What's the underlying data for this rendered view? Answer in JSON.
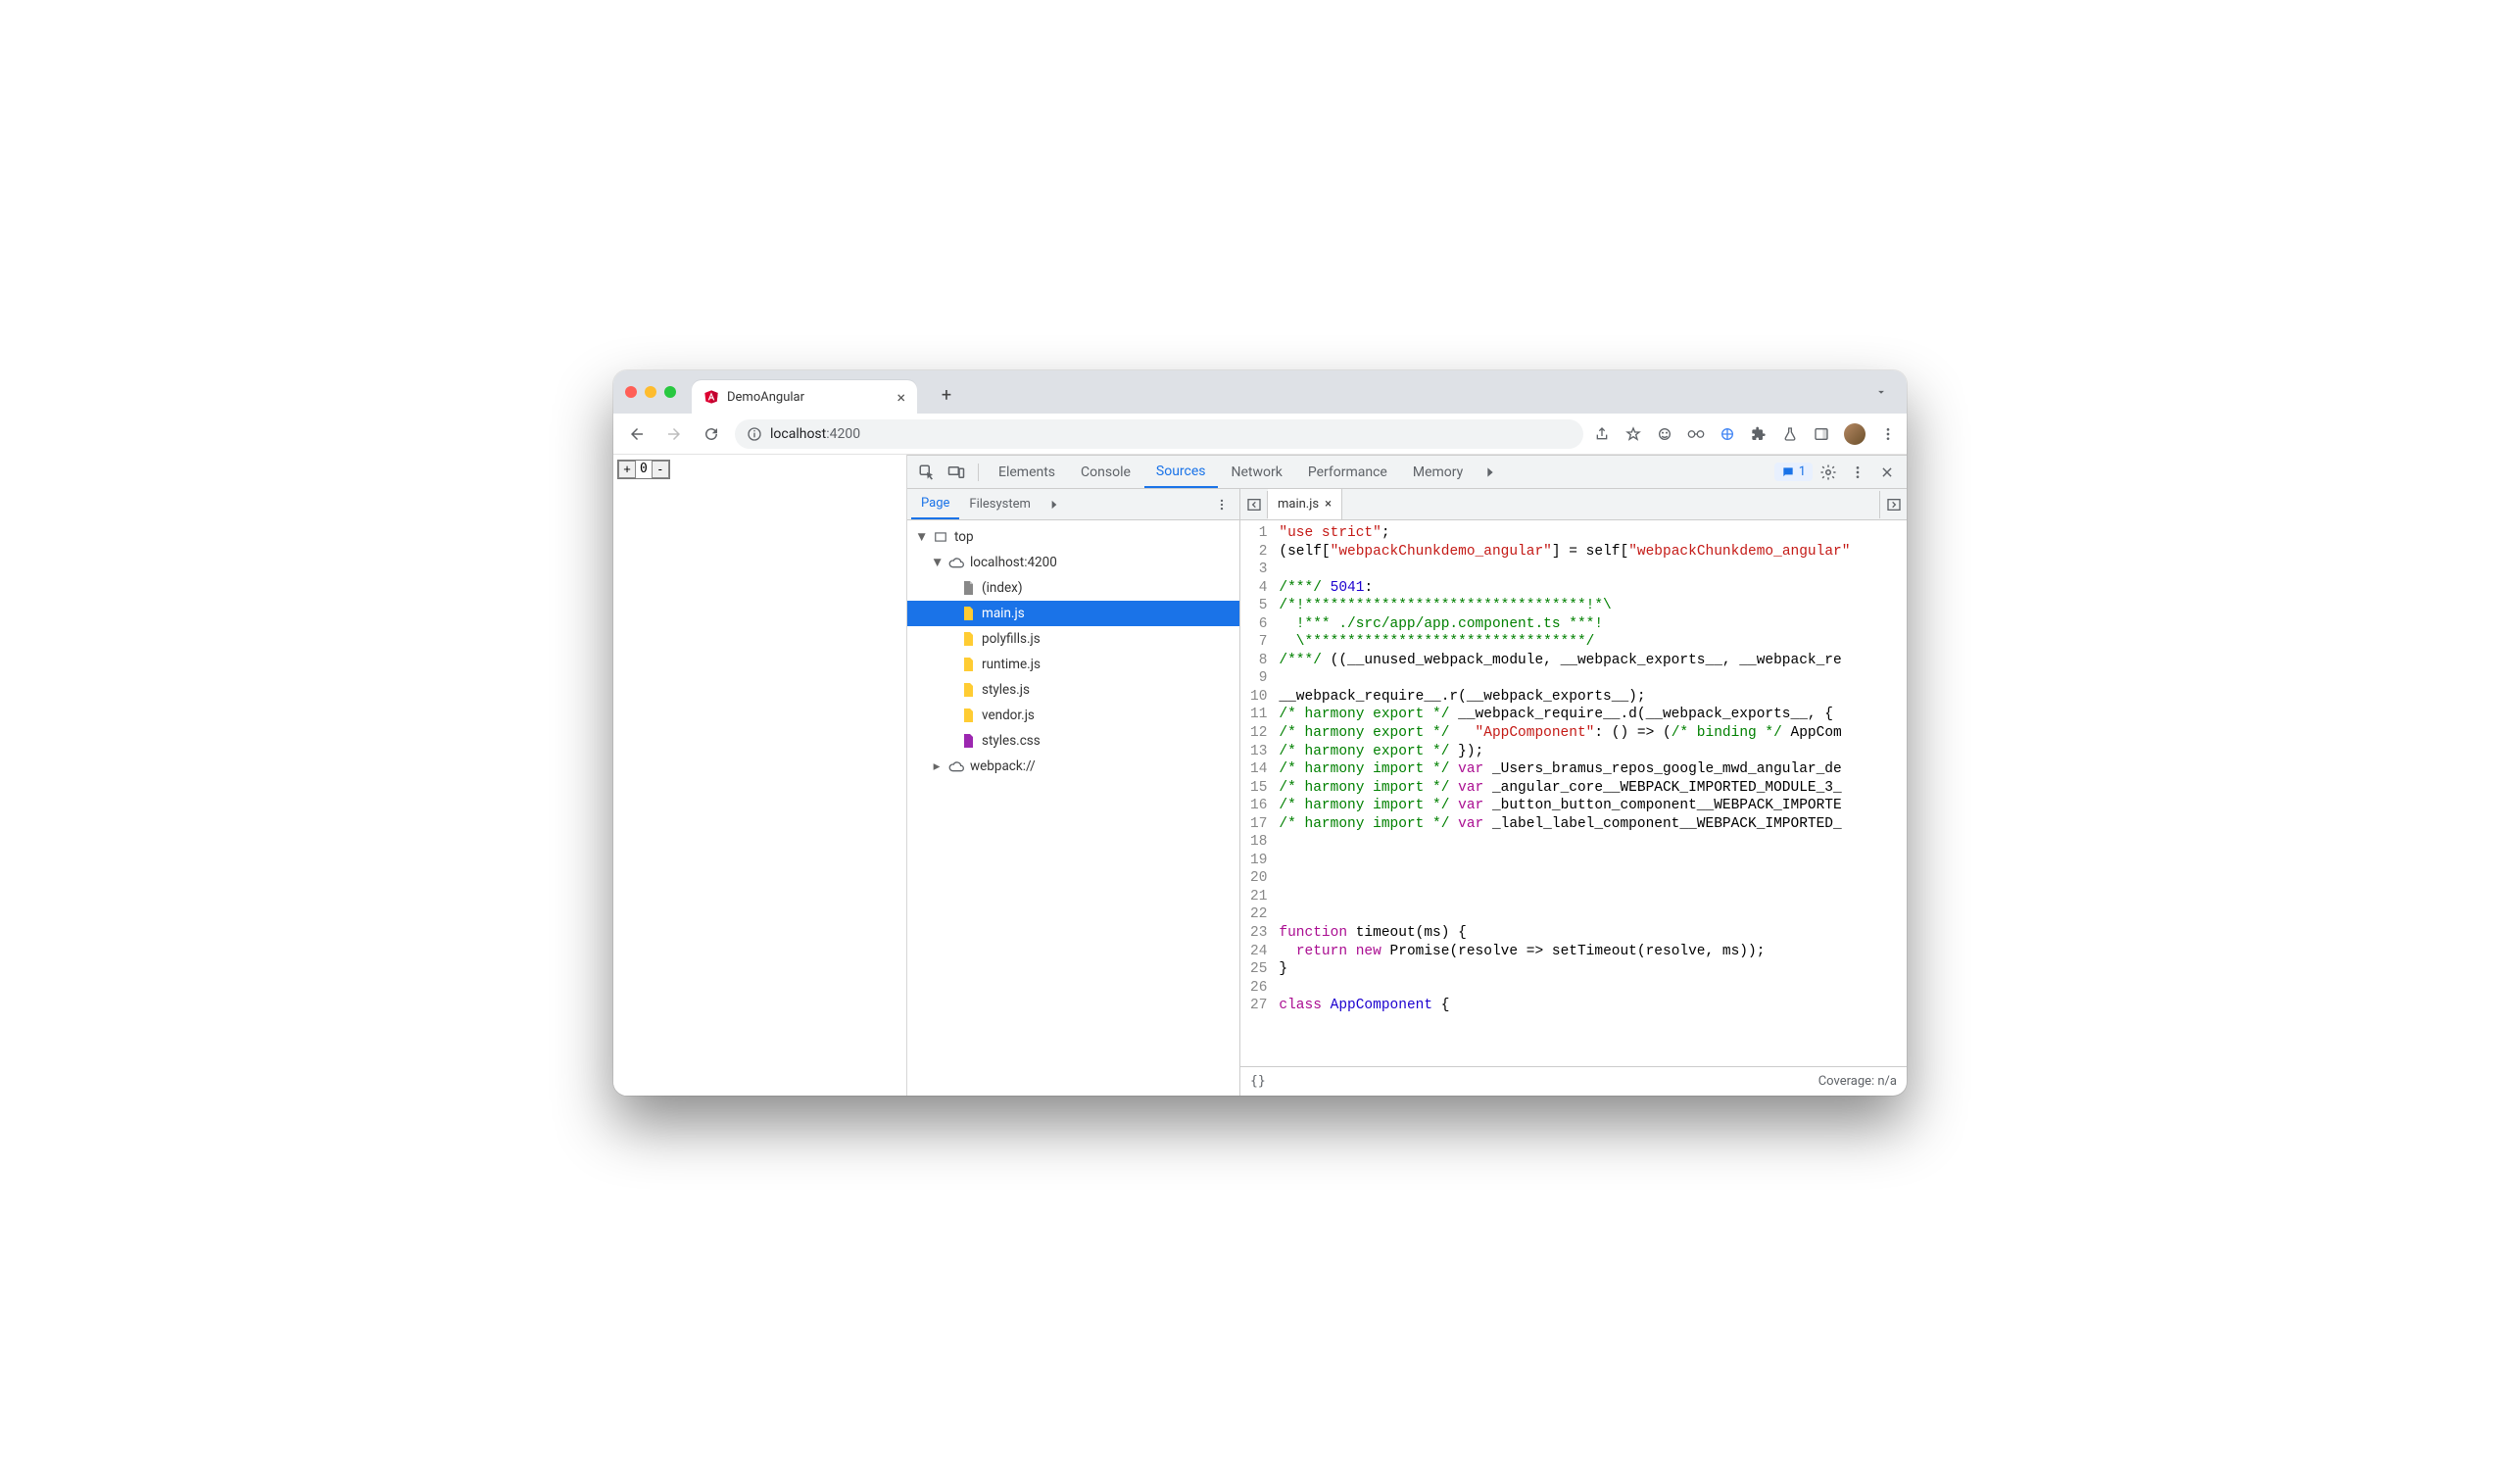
{
  "browser": {
    "tab_title": "DemoAngular",
    "url_display_prefix": "localhost",
    "url_display_suffix": ":4200"
  },
  "page": {
    "counter_value": "0"
  },
  "devtools": {
    "tabs": [
      "Elements",
      "Console",
      "Sources",
      "Network",
      "Performance",
      "Memory"
    ],
    "active_tab": "Sources",
    "issues_count": "1",
    "sources": {
      "left_tabs": [
        "Page",
        "Filesystem"
      ],
      "active_left_tab": "Page",
      "tree": {
        "top": "top",
        "origin": "localhost:4200",
        "files": [
          "(index)",
          "main.js",
          "polyfills.js",
          "runtime.js",
          "styles.js",
          "vendor.js",
          "styles.css"
        ],
        "selected": "main.js",
        "webpack": "webpack://"
      },
      "open_file": "main.js"
    },
    "status": {
      "coverage": "Coverage: n/a"
    },
    "code": {
      "lines": [
        [
          [
            "str",
            "\"use strict\""
          ],
          [
            "pln",
            ";"
          ]
        ],
        [
          [
            "pln",
            "(self["
          ],
          [
            "str",
            "\"webpackChunkdemo_angular\""
          ],
          [
            "pln",
            "] = self["
          ],
          [
            "str",
            "\"webpackChunkdemo_angular\""
          ]
        ],
        [
          [
            "pln",
            ""
          ]
        ],
        [
          [
            "com",
            "/***/ "
          ],
          [
            "num",
            "5041"
          ],
          [
            "pln",
            ":"
          ]
        ],
        [
          [
            "com",
            "/*!*********************************!*\\"
          ]
        ],
        [
          [
            "com",
            "  !*** ./src/app/app.component.ts ***!"
          ]
        ],
        [
          [
            "com",
            "  \\*********************************/"
          ]
        ],
        [
          [
            "com",
            "/***/ "
          ],
          [
            "pln",
            "((__unused_webpack_module, __webpack_exports__, __webpack_re"
          ]
        ],
        [
          [
            "pln",
            ""
          ]
        ],
        [
          [
            "pln",
            "__webpack_require__.r(__webpack_exports__);"
          ]
        ],
        [
          [
            "com",
            "/* harmony export */"
          ],
          [
            "pln",
            " __webpack_require__.d(__webpack_exports__, {"
          ]
        ],
        [
          [
            "com",
            "/* harmony export */"
          ],
          [
            "pln",
            "   "
          ],
          [
            "str",
            "\"AppComponent\""
          ],
          [
            "pln",
            ": () => ("
          ],
          [
            "com",
            "/* binding */"
          ],
          [
            "pln",
            " AppCom"
          ]
        ],
        [
          [
            "com",
            "/* harmony export */"
          ],
          [
            "pln",
            " });"
          ]
        ],
        [
          [
            "com",
            "/* harmony import */"
          ],
          [
            "pln",
            " "
          ],
          [
            "kw",
            "var"
          ],
          [
            "pln",
            " _Users_bramus_repos_google_mwd_angular_de"
          ]
        ],
        [
          [
            "com",
            "/* harmony import */"
          ],
          [
            "pln",
            " "
          ],
          [
            "kw",
            "var"
          ],
          [
            "pln",
            " _angular_core__WEBPACK_IMPORTED_MODULE_3_"
          ]
        ],
        [
          [
            "com",
            "/* harmony import */"
          ],
          [
            "pln",
            " "
          ],
          [
            "kw",
            "var"
          ],
          [
            "pln",
            " _button_button_component__WEBPACK_IMPORTE"
          ]
        ],
        [
          [
            "com",
            "/* harmony import */"
          ],
          [
            "pln",
            " "
          ],
          [
            "kw",
            "var"
          ],
          [
            "pln",
            " _label_label_component__WEBPACK_IMPORTED_"
          ]
        ],
        [
          [
            "pln",
            ""
          ]
        ],
        [
          [
            "pln",
            ""
          ]
        ],
        [
          [
            "pln",
            ""
          ]
        ],
        [
          [
            "pln",
            ""
          ]
        ],
        [
          [
            "pln",
            ""
          ]
        ],
        [
          [
            "kw",
            "function"
          ],
          [
            "pln",
            " "
          ],
          [
            "fn",
            "timeout"
          ],
          [
            "pln",
            "(ms) {"
          ]
        ],
        [
          [
            "pln",
            "  "
          ],
          [
            "kw",
            "return"
          ],
          [
            "pln",
            " "
          ],
          [
            "kw",
            "new"
          ],
          [
            "pln",
            " Promise(resolve => setTimeout(resolve, ms));"
          ]
        ],
        [
          [
            "pln",
            "}"
          ]
        ],
        [
          [
            "pln",
            ""
          ]
        ],
        [
          [
            "kw",
            "class"
          ],
          [
            "pln",
            " "
          ],
          [
            "idex",
            "AppComponent"
          ],
          [
            "pln",
            " {"
          ]
        ]
      ]
    }
  }
}
